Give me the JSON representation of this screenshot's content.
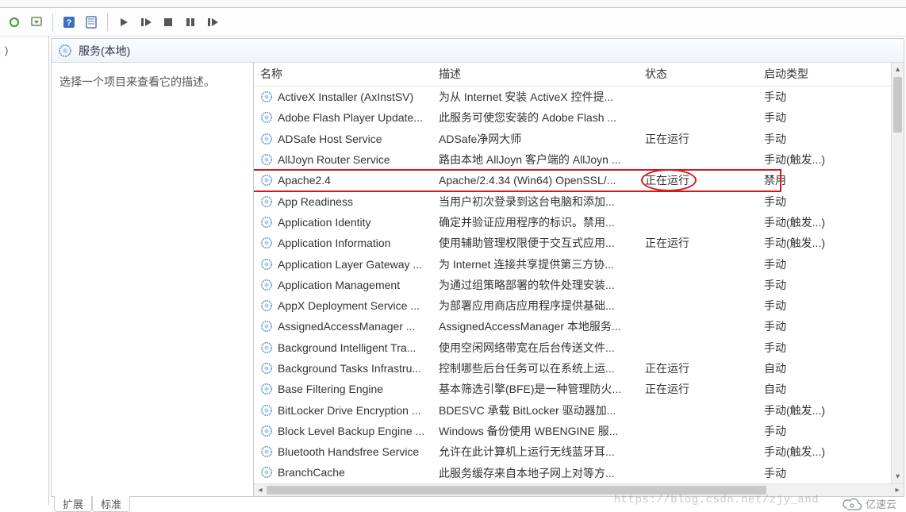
{
  "toolbar_icons": [
    "refresh",
    "export",
    "sep",
    "help",
    "prop",
    "sep",
    "play",
    "pause",
    "stop",
    "pause2",
    "step"
  ],
  "left_pane_text": ")",
  "header": {
    "title": "服务(本地)"
  },
  "detail_pane": {
    "text": "选择一个项目来查看它的描述。"
  },
  "columns": {
    "name": "名称",
    "desc": "描述",
    "state": "状态",
    "start": "启动类型"
  },
  "rows": [
    {
      "name": "ActiveX Installer (AxInstSV)",
      "desc": "为从 Internet 安装 ActiveX 控件提...",
      "state": "",
      "start": "手动"
    },
    {
      "name": "Adobe Flash Player Update...",
      "desc": "此服务可使您安装的 Adobe Flash ...",
      "state": "",
      "start": "手动"
    },
    {
      "name": "ADSafe Host Service",
      "desc": "ADSafe净网大师",
      "state": "正在运行",
      "start": "手动"
    },
    {
      "name": "AllJoyn Router Service",
      "desc": "路由本地 AllJoyn 客户端的 AllJoyn ...",
      "state": "",
      "start": "手动(触发...)"
    },
    {
      "name": "Apache2.4",
      "desc": "Apache/2.4.34 (Win64) OpenSSL/...",
      "state": "正在运行",
      "start": "禁用"
    },
    {
      "name": "App Readiness",
      "desc": "当用户初次登录到这台电脑和添加...",
      "state": "",
      "start": "手动"
    },
    {
      "name": "Application Identity",
      "desc": "确定并验证应用程序的标识。禁用...",
      "state": "",
      "start": "手动(触发...)"
    },
    {
      "name": "Application Information",
      "desc": "使用辅助管理权限便于交互式应用...",
      "state": "正在运行",
      "start": "手动(触发...)"
    },
    {
      "name": "Application Layer Gateway ...",
      "desc": "为 Internet 连接共享提供第三方协...",
      "state": "",
      "start": "手动"
    },
    {
      "name": "Application Management",
      "desc": "为通过组策略部署的软件处理安装...",
      "state": "",
      "start": "手动"
    },
    {
      "name": "AppX Deployment Service ...",
      "desc": "为部署应用商店应用程序提供基础...",
      "state": "",
      "start": "手动"
    },
    {
      "name": "AssignedAccessManager ...",
      "desc": "AssignedAccessManager 本地服务...",
      "state": "",
      "start": "手动"
    },
    {
      "name": "Background Intelligent Tra...",
      "desc": "使用空闲网络带宽在后台传送文件...",
      "state": "",
      "start": "手动"
    },
    {
      "name": "Background Tasks Infrastru...",
      "desc": "控制哪些后台任务可以在系统上运...",
      "state": "正在运行",
      "start": "自动"
    },
    {
      "name": "Base Filtering Engine",
      "desc": "基本筛选引擎(BFE)是一种管理防火...",
      "state": "正在运行",
      "start": "自动"
    },
    {
      "name": "BitLocker Drive Encryption ...",
      "desc": "BDESVC 承载 BitLocker 驱动器加...",
      "state": "",
      "start": "手动(触发...)"
    },
    {
      "name": "Block Level Backup Engine ...",
      "desc": "Windows 备份使用 WBENGINE 服...",
      "state": "",
      "start": "手动"
    },
    {
      "name": "Bluetooth Handsfree Service",
      "desc": "允许在此计算机上运行无线蓝牙耳...",
      "state": "",
      "start": "手动(触发...)"
    },
    {
      "name": "BranchCache",
      "desc": "此服务缓存来自本地子网上对等方...",
      "state": "",
      "start": "手动"
    }
  ],
  "tabs": {
    "extended": "扩展",
    "standard": "标准"
  },
  "watermark": {
    "url": "https://blog.csdn.net/zjy_and",
    "brand": "亿速云"
  }
}
